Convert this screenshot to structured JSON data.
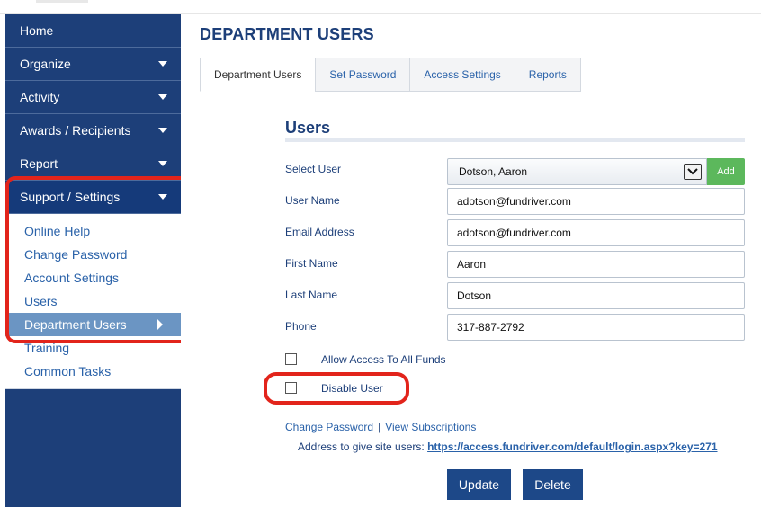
{
  "sidebar": {
    "items": [
      {
        "label": "Home"
      },
      {
        "label": "Organize"
      },
      {
        "label": "Activity"
      },
      {
        "label": "Awards / Recipients"
      },
      {
        "label": "Report"
      },
      {
        "label": "Support / Settings"
      }
    ],
    "submenu": [
      {
        "label": "Online Help"
      },
      {
        "label": "Change Password"
      },
      {
        "label": "Account Settings"
      },
      {
        "label": "Users"
      },
      {
        "label": "Department Users"
      },
      {
        "label": "Training"
      },
      {
        "label": "Common Tasks"
      }
    ]
  },
  "main": {
    "title": "DEPARTMENT USERS",
    "tabs": [
      {
        "label": "Department Users"
      },
      {
        "label": "Set Password"
      },
      {
        "label": "Access Settings"
      },
      {
        "label": "Reports"
      }
    ],
    "section_title": "Users",
    "form": {
      "select_user_label": "Select User",
      "select_user_value": "Dotson, Aaron",
      "add_label": "Add",
      "user_name_label": "User Name",
      "user_name_value": "adotson@fundriver.com",
      "email_label": "Email Address",
      "email_value": "adotson@fundriver.com",
      "first_name_label": "First Name",
      "first_name_value": "Aaron",
      "last_name_label": "Last Name",
      "last_name_value": "Dotson",
      "phone_label": "Phone",
      "phone_value": "317-887-2792",
      "allow_access_label": "Allow Access To All Funds",
      "disable_user_label": "Disable User"
    },
    "links": {
      "change_password": "Change Password",
      "separator": "|",
      "view_subscriptions": "View Subscriptions"
    },
    "address": {
      "label": "Address to give site users:",
      "url": "https://access.fundriver.com/default/login.aspx?key=271"
    },
    "buttons": {
      "update": "Update",
      "delete": "Delete"
    }
  },
  "colors": {
    "sidebar_bg": "#1d3f79",
    "highlight": "#e2241b",
    "add_button": "#5cb85c",
    "primary_button": "#1d4888",
    "link": "#2a62a9"
  }
}
